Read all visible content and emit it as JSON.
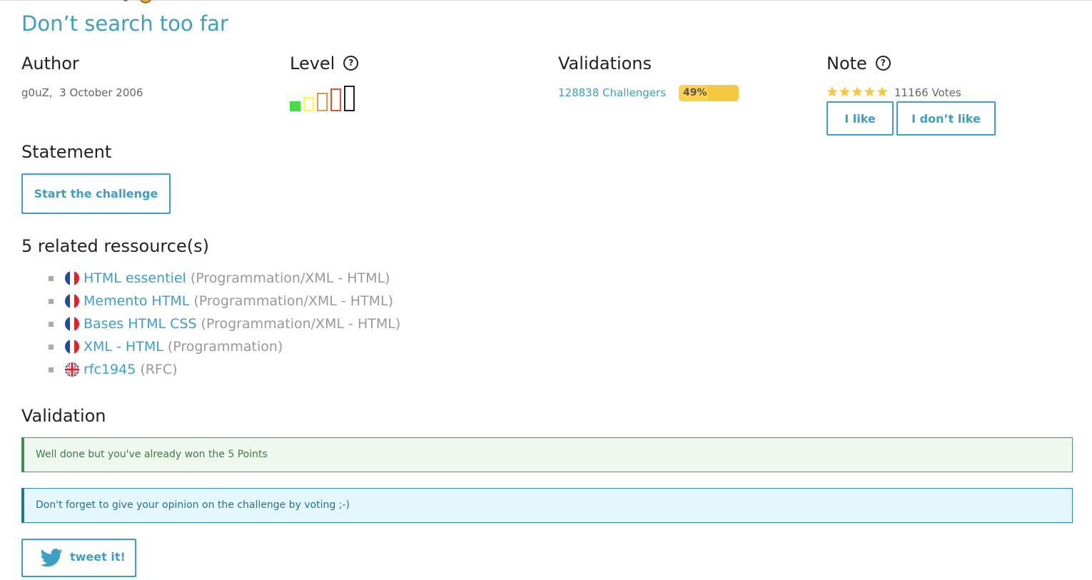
{
  "challenge": {
    "title": "Don’t search too far"
  },
  "author": {
    "heading": "Author",
    "name": "g0uZ",
    "date": "3 October 2006"
  },
  "level": {
    "heading": "Level",
    "help_icon": "question-circle-icon",
    "current_level": 1,
    "max_level": 5,
    "colors": [
      "#44dd44",
      "#ffff33",
      "#e09a4a",
      "#dd5533",
      "#222222"
    ]
  },
  "validations": {
    "heading": "Validations",
    "challengers": "128838 Challengers",
    "percent_label": "49%",
    "percent": 49
  },
  "note": {
    "heading": "Note",
    "help_icon": "question-circle-icon",
    "stars": 5,
    "star_color": "#f5c842",
    "votes": "11166 Votes",
    "like_label": "I like",
    "dislike_label": "I don’t like"
  },
  "statement": {
    "heading": "Statement",
    "start_label": "Start the challenge"
  },
  "resources": {
    "heading": "5 related ressource(s)",
    "items": [
      {
        "flag": "fr-flag-icon",
        "title": "HTML essentiel",
        "category": "(Programmation/XML - HTML)"
      },
      {
        "flag": "fr-flag-icon",
        "title": "Memento HTML",
        "category": "(Programmation/XML - HTML)"
      },
      {
        "flag": "fr-flag-icon",
        "title": "Bases HTML CSS",
        "category": "(Programmation/XML - HTML)"
      },
      {
        "flag": "fr-flag-icon",
        "title": "XML - HTML",
        "category": "(Programmation)"
      },
      {
        "flag": "uk-flag-icon",
        "title": "rfc1945",
        "category": "(RFC)"
      }
    ]
  },
  "validation": {
    "heading": "Validation",
    "success_message": "Well done but you've already won the 5 Points",
    "info_message": "Don't forget to give your opinion on the challenge by voting ;-)",
    "tweet_label": "tweet it!"
  },
  "colors": {
    "accent": "#3c9fc4",
    "success": "#3e8d53",
    "info": "#1f7894"
  }
}
